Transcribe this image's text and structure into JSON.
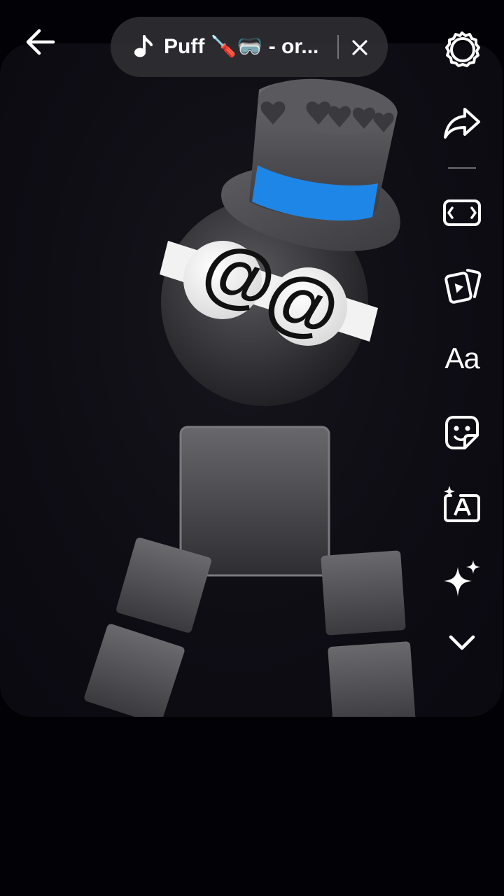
{
  "navigation": {
    "back_icon": "arrow-left-icon"
  },
  "sound": {
    "icon": "music-note-icon",
    "title": "Puff 🪛🥽 - or...",
    "close_icon": "close-icon"
  },
  "editor_tools": [
    {
      "id": "settings",
      "icon": "gear-icon"
    },
    {
      "id": "share",
      "icon": "share-arrow-icon"
    },
    {
      "id": "aspect",
      "icon": "aspect-ratio-icon"
    },
    {
      "id": "clips",
      "icon": "clips-icon"
    },
    {
      "id": "text",
      "icon": "text-icon",
      "label": "Aa"
    },
    {
      "id": "stickers",
      "icon": "sticker-icon"
    },
    {
      "id": "captions",
      "icon": "auto-captions-icon"
    },
    {
      "id": "effects",
      "icon": "sparkle-effects-icon"
    },
    {
      "id": "more",
      "icon": "chevron-down-icon"
    }
  ],
  "video": {
    "eye_text_left": "@",
    "eye_text_right": "@"
  },
  "colors": {
    "background": "#020105",
    "pill": "#303034",
    "hat_band": "#1e86e6",
    "icon": "#ffffff"
  }
}
